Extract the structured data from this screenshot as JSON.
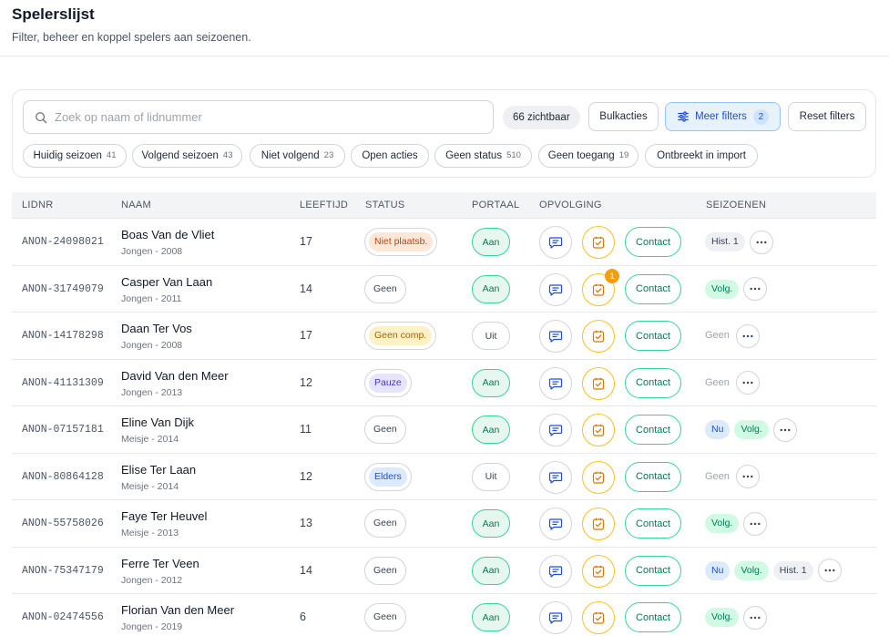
{
  "header": {
    "title": "Spelerslijst",
    "subtitle": "Filter, beheer en koppel spelers aan seizoenen."
  },
  "toolbar": {
    "search_placeholder": "Zoek op naam of lidnummer",
    "search_value": "",
    "visible_count": "66 zichtbaar",
    "bulk_label": "Bulkacties",
    "more_filters_label": "Meer filters",
    "more_filters_count": "2",
    "reset_label": "Reset filters"
  },
  "chips": [
    {
      "label": "Huidig seizoen",
      "count": "41"
    },
    {
      "label": "Volgend seizoen",
      "count": "43"
    },
    {
      "label": "Niet volgend",
      "count": "23"
    },
    {
      "label": "Open acties",
      "count": ""
    },
    {
      "label": "Geen status",
      "count": "510"
    },
    {
      "label": "Geen toegang",
      "count": "19"
    },
    {
      "label": "Ontbreekt in import",
      "count": ""
    }
  ],
  "table": {
    "columns": [
      "LIDNR",
      "NAAM",
      "LEEFTIJD",
      "STATUS",
      "PORTAAL",
      "OPVOLGING",
      "SEIZOENEN"
    ],
    "contact_label": "Contact",
    "rows": [
      {
        "lid": "ANON-24098021",
        "name": "Boas Van de Vliet",
        "sub": "Jongen - 2008",
        "age": "17",
        "status": "Niet plaatsb.",
        "status_style": "orange",
        "portal": "Aan",
        "task_badge": "",
        "seasons": [
          {
            "label": "Hist. 1",
            "kind": "hist"
          }
        ]
      },
      {
        "lid": "ANON-31749079",
        "name": "Casper Van Laan",
        "sub": "Jongen - 2011",
        "age": "14",
        "status": "Geen",
        "status_style": "plain",
        "portal": "Aan",
        "task_badge": "1",
        "seasons": [
          {
            "label": "Volg.",
            "kind": "volg"
          }
        ]
      },
      {
        "lid": "ANON-14178298",
        "name": "Daan Ter Vos",
        "sub": "Jongen - 2008",
        "age": "17",
        "status": "Geen comp.",
        "status_style": "yellow",
        "portal": "Uit",
        "task_badge": "",
        "seasons": [
          {
            "label": "Geen",
            "kind": "none"
          }
        ]
      },
      {
        "lid": "ANON-41131309",
        "name": "David Van den Meer",
        "sub": "Jongen - 2013",
        "age": "12",
        "status": "Pauze",
        "status_style": "purple",
        "portal": "Aan",
        "task_badge": "",
        "seasons": [
          {
            "label": "Geen",
            "kind": "none"
          }
        ]
      },
      {
        "lid": "ANON-07157181",
        "name": "Eline Van Dijk",
        "sub": "Meisje - 2014",
        "age": "11",
        "status": "Geen",
        "status_style": "plain",
        "portal": "Aan",
        "task_badge": "",
        "seasons": [
          {
            "label": "Nu",
            "kind": "nu"
          },
          {
            "label": "Volg.",
            "kind": "volg"
          }
        ]
      },
      {
        "lid": "ANON-80864128",
        "name": "Elise Ter Laan",
        "sub": "Meisje - 2014",
        "age": "12",
        "status": "Elders",
        "status_style": "blue",
        "portal": "Uit",
        "task_badge": "",
        "seasons": [
          {
            "label": "Geen",
            "kind": "none"
          }
        ]
      },
      {
        "lid": "ANON-55758026",
        "name": "Faye Ter Heuvel",
        "sub": "Meisje - 2013",
        "age": "13",
        "status": "Geen",
        "status_style": "plain",
        "portal": "Aan",
        "task_badge": "",
        "seasons": [
          {
            "label": "Volg.",
            "kind": "volg"
          }
        ]
      },
      {
        "lid": "ANON-75347179",
        "name": "Ferre Ter Veen",
        "sub": "Jongen - 2012",
        "age": "14",
        "status": "Geen",
        "status_style": "plain",
        "portal": "Aan",
        "task_badge": "",
        "seasons": [
          {
            "label": "Nu",
            "kind": "nu"
          },
          {
            "label": "Volg.",
            "kind": "volg"
          },
          {
            "label": "Hist. 1",
            "kind": "hist"
          }
        ]
      },
      {
        "lid": "ANON-02474556",
        "name": "Florian Van den Meer",
        "sub": "Jongen - 2019",
        "age": "6",
        "status": "Geen",
        "status_style": "plain",
        "portal": "Aan",
        "task_badge": "",
        "seasons": [
          {
            "label": "Volg.",
            "kind": "volg"
          }
        ]
      }
    ]
  },
  "icons": {
    "search": "search-icon",
    "filters": "sliders-icon",
    "message": "message-icon",
    "task": "task-check-icon",
    "more": "more-horizontal-icon"
  },
  "colors": {
    "accent_blue": "#1d4ed8",
    "accent_green": "#047857",
    "task_orange": "#f59e0b"
  }
}
